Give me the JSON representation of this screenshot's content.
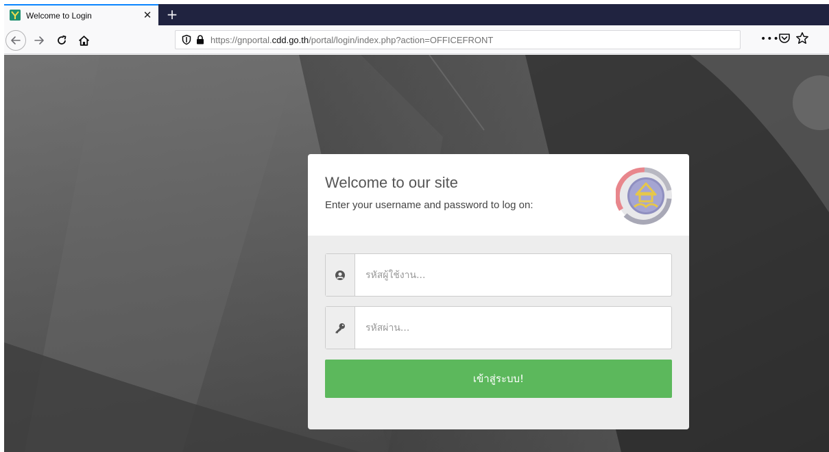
{
  "browser": {
    "tab": {
      "title": "Welcome to Login",
      "close_glyph": "✕",
      "favicon": "cdd-favicon"
    },
    "new_tab_glyph": "+",
    "nav": {
      "back_icon": "back-arrow-icon",
      "forward_icon": "forward-arrow-icon",
      "reload_icon": "reload-icon",
      "home_icon": "home-icon"
    },
    "url": {
      "prefix": "https://gnportal.",
      "domain": "cdd.go.th",
      "path": "/portal/login/index.php?action=OFFICEFRONT"
    },
    "more_glyph": "•••"
  },
  "login": {
    "title": "Welcome to our site",
    "subtitle": "Enter your username and password to log on:",
    "username": {
      "placeholder": "รหัสผู้ใช้งาน...",
      "value": "",
      "icon": "user-icon"
    },
    "password": {
      "placeholder": "รหัสผ่าน...",
      "value": "",
      "icon": "key-icon"
    },
    "submit_label": "เข้าสู่ระบบ!"
  },
  "colors": {
    "tabstrip": "#202340",
    "accent_tab": "#0a84ff",
    "submit": "#5cb85c",
    "page_bg": "#565656"
  }
}
